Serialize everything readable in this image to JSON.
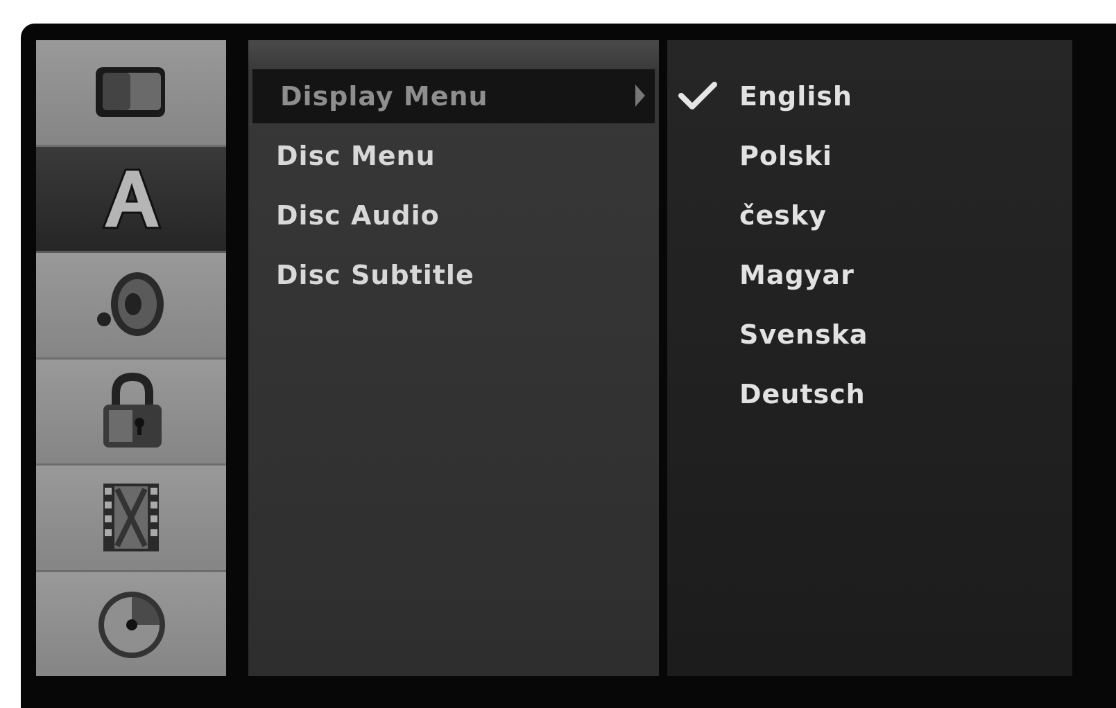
{
  "sidebar": {
    "items": [
      {
        "icon": "tv-icon",
        "active": false
      },
      {
        "icon": "language-a-icon",
        "active": true
      },
      {
        "icon": "speaker-icon",
        "active": false
      },
      {
        "icon": "lock-icon",
        "active": false
      },
      {
        "icon": "film-icon",
        "active": false
      },
      {
        "icon": "disc-icon",
        "active": false
      }
    ]
  },
  "menu": {
    "items": [
      {
        "label": "Display Menu",
        "selected": true
      },
      {
        "label": "Disc Menu",
        "selected": false
      },
      {
        "label": "Disc Audio",
        "selected": false
      },
      {
        "label": "Disc Subtitle",
        "selected": false
      }
    ]
  },
  "options": {
    "items": [
      {
        "label": "English",
        "checked": true
      },
      {
        "label": "Polski",
        "checked": false
      },
      {
        "label": "česky",
        "checked": false
      },
      {
        "label": "Magyar",
        "checked": false
      },
      {
        "label": "Svenska",
        "checked": false
      },
      {
        "label": "Deutsch",
        "checked": false
      }
    ]
  },
  "colors": {
    "sidebar": "#8a8a8a",
    "sidebar_active": "#2e2e2e",
    "menu_panel": "#333333",
    "options_panel": "#222222",
    "text": "#e0e0e0"
  }
}
